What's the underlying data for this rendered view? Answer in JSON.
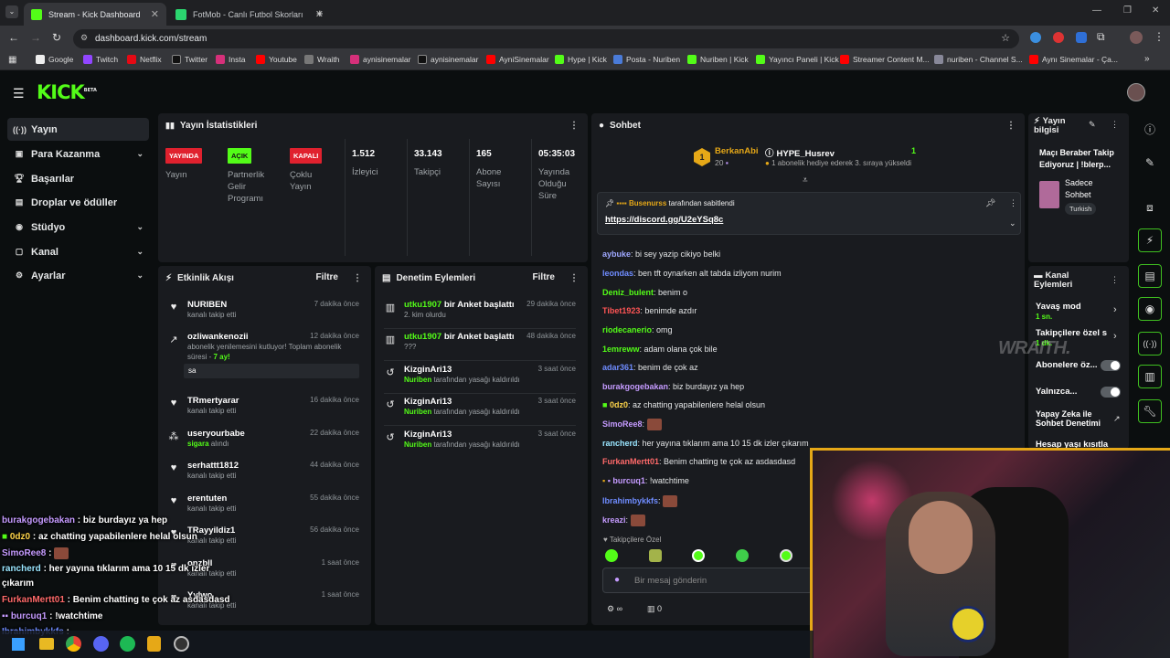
{
  "browser": {
    "tabs": [
      {
        "label": "Stream - Kick Dashboard"
      },
      {
        "label": "FotMob - Canlı Futbol Skorları"
      }
    ],
    "url": "dashboard.kick.com/stream",
    "bookmarks": [
      "Google",
      "Twitch",
      "Netflix",
      "Twitter",
      "Insta",
      "Youtube",
      "Wraith",
      "aynisinemalar",
      "aynisinemalar",
      "AyniSinemalar",
      "Hype | Kick",
      "Posta - Nuriben",
      "Nuriben | Kick",
      "Yayıncı Paneli | Kick",
      "Streamer Content M...",
      "nuriben - Channel S...",
      "Aynı Sinemalar - Ça..."
    ]
  },
  "brand": {
    "logo": "KICK",
    "beta": "BETA"
  },
  "sidebar": {
    "items": [
      {
        "label": "Yayın"
      },
      {
        "label": "Para Kazanma"
      },
      {
        "label": "Başarılar"
      },
      {
        "label": "Droplar ve ödüller"
      },
      {
        "label": "Stüdyo"
      },
      {
        "label": "Kanal"
      },
      {
        "label": "Ayarlar"
      }
    ]
  },
  "stats": {
    "title": "Yayın İstatistikleri",
    "items": [
      {
        "badge": "YAYINDA",
        "label": "Yayın"
      },
      {
        "badge": "AÇIK",
        "label": "Partnerlik Gelir Programı"
      },
      {
        "badge": "KAPALI",
        "label": "Çoklu Yayın"
      },
      {
        "value": "1.512",
        "label": "İzleyici"
      },
      {
        "value": "33.143",
        "label": "Takipçi"
      },
      {
        "value": "165",
        "label": "Abone Sayısı"
      },
      {
        "value": "05:35:03",
        "label": "Yayında Olduğu Süre"
      }
    ]
  },
  "activity": {
    "title": "Etkinlik Akışı",
    "filter": "Filtre",
    "items": [
      {
        "name": "NURIBEN",
        "time": "7 dakika önce",
        "sub": "kanalı takip etti"
      },
      {
        "name": "ozliwankenozii",
        "time": "12 dakika önce",
        "sub": "abonelik yenilemesini kutluyor! Toplam abonelik",
        "sub2": "süresi - ",
        "sub2b": "7 ay!",
        "msg": "sa"
      },
      {
        "name": "TRmertyarar",
        "time": "16 dakika önce",
        "sub": "kanalı takip etti"
      },
      {
        "name": "useryourbabe",
        "time": "22 dakika önce",
        "sub": "sigara",
        "subb": " alındı"
      },
      {
        "name": "serhattt1812",
        "time": "44 dakika önce",
        "sub": "kanalı takip etti"
      },
      {
        "name": "erentuten",
        "time": "55 dakika önce",
        "sub": "kanalı takip etti"
      },
      {
        "name": "TRayyildiz1",
        "time": "56 dakika önce",
        "sub": "kanalı takip etti"
      },
      {
        "name": "onzbll",
        "time": "1 saat önce",
        "sub": "kanalı takip etti"
      },
      {
        "name": "Yylwo",
        "time": "1 saat önce",
        "sub": "kanalı takip etti"
      }
    ]
  },
  "moderation": {
    "title": "Denetim Eylemleri",
    "filter": "Filtre",
    "items": [
      {
        "name": "utku1907",
        "action": " bir Anket başlattı",
        "time": "29 dakika önce",
        "sub": "2. kim olurdu"
      },
      {
        "name": "utku1907",
        "action": " bir Anket başlattı",
        "time": "48 dakika önce",
        "sub": "???"
      },
      {
        "name": "KizginAri13",
        "time": "3 saat önce",
        "subb": "Nuriben",
        "sub": " tarafından yasağı kaldırıldı"
      },
      {
        "name": "KizginAri13",
        "time": "3 saat önce",
        "subb": "Nuriben",
        "sub": " tarafından yasağı kaldırıldı"
      },
      {
        "name": "KizginAri13",
        "time": "3 saat önce",
        "subb": "Nuriben",
        "sub": " tarafından yasağı kaldırıldı"
      }
    ]
  },
  "chat": {
    "title": "Sohbet",
    "top": {
      "user": "BerkanAbi",
      "count": "20",
      "rank": "1",
      "hype_user": "HYPE_Husrev",
      "hype_count": "1",
      "hype_text": "1 abonelik hediye ederek 3. sıraya yükseldi"
    },
    "pinned": {
      "by": "Busenurss",
      "text": " tarafından sabitlendi",
      "link": "https://discord.gg/U2eYSq8c"
    },
    "messages": [
      {
        "user": "aybuke",
        "color": "#9fa8ff",
        "text": ": bi sey yazip cikiyo belki"
      },
      {
        "user": "leondas",
        "color": "#6f8cff",
        "text": ": ben tft oynarken alt tabda izliyom nurim"
      },
      {
        "user": "Deniz_bulent",
        "color": "#53fc18",
        "text": ": benim o"
      },
      {
        "user": "Tibet1923",
        "color": "#ff5555",
        "text": ": benimde azdır"
      },
      {
        "user": "riodecanerio",
        "color": "#53fc18",
        "text": ": omg"
      },
      {
        "user": "1emreww",
        "color": "#53fc18",
        "text": ": adam olana çok bile"
      },
      {
        "user": "adar361",
        "color": "#6f8cff",
        "text": ": benim de çok az"
      },
      {
        "user": "burakgogebakan",
        "color": "#c59bff",
        "text": ": biz burdayız ya hep"
      },
      {
        "user": "0dz0",
        "color": "#ffd54a",
        "text": ": az chatting yapabilenlere helal olsun"
      },
      {
        "user": "SimoRee8",
        "color": "#c59bff",
        "text": ":"
      },
      {
        "user": "rancherd",
        "color": "#9ae6ff",
        "text": ": her yayına tıklarım ama 10 15 dk izler çıkarım"
      },
      {
        "user": "FurkanMertt01",
        "color": "#ff6a6a",
        "text": ": Benim chatting te çok az asdasdasd"
      },
      {
        "user": "burcuq1",
        "color": "#c59bff",
        "text": ": !watchtime"
      },
      {
        "user": "Ibrahimbykkfs",
        "color": "#6f8cff",
        "text": ":"
      },
      {
        "user": "kreazi",
        "color": "#c59bff",
        "text": ":"
      }
    ],
    "mode": "Takipçilere Özel",
    "input_placeholder": "Bir mesaj gönderin",
    "viewers": "0"
  },
  "info": {
    "title": "Yayın bilgisi",
    "stream_title": "Maçı Beraber Takip Ediyoruz | !blerp...",
    "category": "Sadece Sohbet",
    "tag": "Turkish"
  },
  "channel_actions": {
    "title": "Kanal Eylemleri",
    "items": [
      {
        "label": "Yavaş mod",
        "sub": "1 sn."
      },
      {
        "label": "Takipçilere özel s",
        "sub": "1 dk."
      },
      {
        "label": "Abonelere öz..."
      },
      {
        "label": "Yalnızca..."
      },
      {
        "label": "Yapay Zeka ile Sohbet Denetimi"
      },
      {
        "label": "Hesap yaşı kısıtla"
      }
    ]
  },
  "overlay": {
    "lines": [
      {
        "user": "burakgogebakan",
        "text": " : biz burdayız ya hep"
      },
      {
        "user": "0dz0",
        "text": " : az chatting yapabilenlere helal olsun"
      },
      {
        "user": "SimoRee8",
        "text": " :"
      },
      {
        "user": "rancherd",
        "text": " : her yayına tıklarım ama 10 15 dk izler"
      },
      {
        "user": "",
        "text": "çıkarım"
      },
      {
        "user": "FurkanMertt01",
        "text": " : Benim chatting te çok az asdasdasd"
      },
      {
        "user": "burcuq1",
        "text": " : !watchtime"
      },
      {
        "user": "Ibrahimbykkfs",
        "text": " :"
      }
    ],
    "watermark": "WRAITH."
  }
}
